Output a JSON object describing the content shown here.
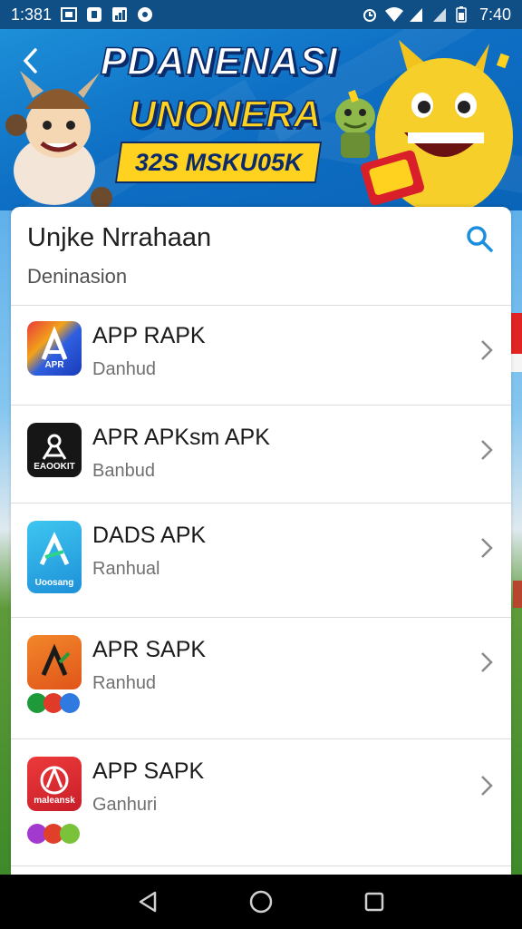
{
  "status_bar": {
    "time_left": "1:381",
    "time_right": "7:40",
    "icons": [
      "gallery-icon",
      "app-icon",
      "signal-chart-icon",
      "notification-icon",
      "alarm-icon",
      "wifi-icon",
      "signal-icon",
      "signal-icon",
      "battery-icon"
    ]
  },
  "banner": {
    "title": "PDANENASI",
    "subtitle": "UNONERA",
    "tag": "32S MSKU05K"
  },
  "card": {
    "title": "Unjke Nrrahaan",
    "subtitle": "Deninasion"
  },
  "apps": [
    {
      "name": "APP RAPK",
      "sub": "Danhud",
      "icon_caption": "APR",
      "icon_color": "#2f5fe0"
    },
    {
      "name": "APR APKsm APK",
      "sub": "Banbud",
      "icon_caption": "EAOOKIT",
      "icon_color": "#1a1a1a"
    },
    {
      "name": "DADS APK",
      "sub": "Ranhual",
      "icon_caption": "Uoosang",
      "icon_color": "#2aa8e0"
    },
    {
      "name": "APR SAPK",
      "sub": "Ranhud",
      "icon_caption": "",
      "icon_color": "#f07a1a"
    },
    {
      "name": "APP SAPK",
      "sub": "Ganhuri",
      "icon_caption": "maleansk",
      "icon_color": "#e02b36"
    }
  ],
  "colors": {
    "accent": "#1a8fe0",
    "banner_yellow": "#ffd21f",
    "nav_background": "#000000"
  }
}
